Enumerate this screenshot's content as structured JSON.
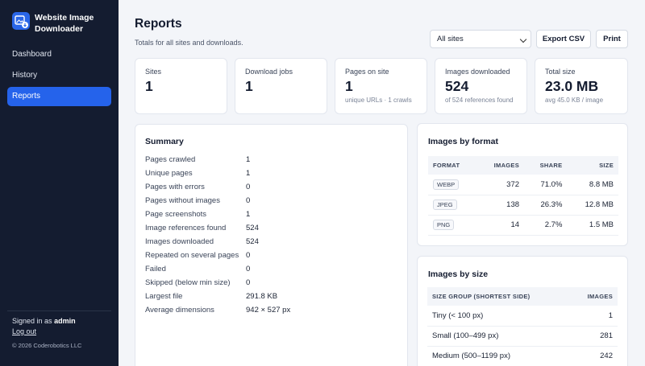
{
  "sidebar": {
    "brand": "Website Image Downloader",
    "items": [
      {
        "label": "Dashboard"
      },
      {
        "label": "History"
      },
      {
        "label": "Reports"
      }
    ],
    "signed_in_prefix": "Signed in as",
    "user": "admin",
    "logout": "Log out",
    "copyright": "© 2026 Coderobotics LLC"
  },
  "header": {
    "title": "Reports",
    "subtitle": "Totals for all sites and downloads.",
    "site_filter": "All sites",
    "export_label": "Export CSV",
    "print_label": "Print"
  },
  "stats": [
    {
      "label": "Sites",
      "value": "1",
      "sub": ""
    },
    {
      "label": "Download jobs",
      "value": "1",
      "sub": ""
    },
    {
      "label": "Pages on site",
      "value": "1",
      "sub": "unique URLs · 1 crawls"
    },
    {
      "label": "Images downloaded",
      "value": "524",
      "sub": "of 524 references found"
    },
    {
      "label": "Total size",
      "value": "23.0 MB",
      "sub": "avg 45.0 KB / image"
    }
  ],
  "summary": {
    "title": "Summary",
    "rows": [
      {
        "k": "Pages crawled",
        "v": "1"
      },
      {
        "k": "Unique pages",
        "v": "1"
      },
      {
        "k": "Pages with errors",
        "v": "0"
      },
      {
        "k": "Pages without images",
        "v": "0"
      },
      {
        "k": "Page screenshots",
        "v": "1"
      },
      {
        "k": "Image references found",
        "v": "524"
      },
      {
        "k": "Images downloaded",
        "v": "524"
      },
      {
        "k": "Repeated on several pages",
        "v": "0"
      },
      {
        "k": "Failed",
        "v": "0"
      },
      {
        "k": "Skipped (below min size)",
        "v": "0"
      },
      {
        "k": "Largest file",
        "v": "291.8 KB"
      },
      {
        "k": "Average dimensions",
        "v": "942 × 527 px"
      }
    ]
  },
  "formats": {
    "title": "Images by format",
    "headers": [
      "FORMAT",
      "IMAGES",
      "SHARE",
      "SIZE"
    ],
    "rows": [
      {
        "format": "WEBP",
        "images": "372",
        "share": "71.0%",
        "size": "8.8 MB"
      },
      {
        "format": "JPEG",
        "images": "138",
        "share": "26.3%",
        "size": "12.8 MB"
      },
      {
        "format": "PNG",
        "images": "14",
        "share": "2.7%",
        "size": "1.5 MB"
      }
    ]
  },
  "sizes": {
    "title": "Images by size",
    "headers": [
      "SIZE GROUP (SHORTEST SIDE)",
      "IMAGES"
    ],
    "rows": [
      {
        "group": "Tiny (< 100 px)",
        "images": "1"
      },
      {
        "group": "Small (100–499 px)",
        "images": "281"
      },
      {
        "group": "Medium (500–1199 px)",
        "images": "242"
      }
    ]
  }
}
